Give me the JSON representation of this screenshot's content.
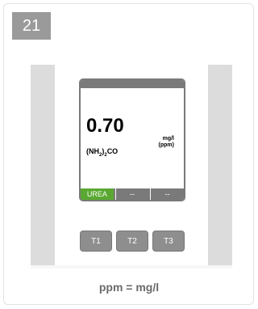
{
  "step": {
    "number": "21"
  },
  "lcd": {
    "value": "0.70",
    "unit_line1": "mg/l",
    "unit_line2": "(ppm)",
    "formula_prefix": "(NH",
    "formula_sub": "2",
    "formula_mid": ")",
    "formula_sub2": "2",
    "formula_suffix": "CO",
    "tabs": [
      {
        "label": "UREA",
        "active": true
      },
      {
        "label": "--",
        "active": false
      },
      {
        "label": "--",
        "active": false
      }
    ]
  },
  "buttons": {
    "t1": "T1",
    "t2": "T2",
    "t3": "T3"
  },
  "caption": "ppm = mg/l",
  "colors": {
    "badge": "#9a9a9a",
    "active_tab": "#5aa832",
    "lcd_frame": "#7a7a7a",
    "softkey": "#8e8e8e"
  }
}
